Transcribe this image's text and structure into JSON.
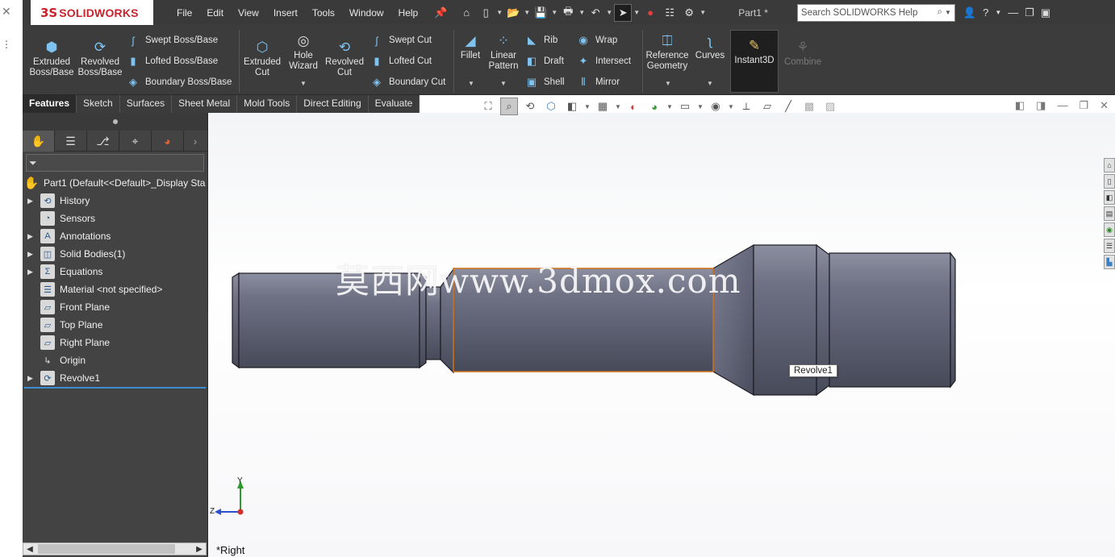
{
  "app": {
    "brand_prefix": "3S",
    "brand_name": "SOLIDWORKS",
    "document_title": "Part1 *",
    "search_placeholder": "Search SOLIDWORKS Help"
  },
  "menu": [
    "File",
    "Edit",
    "View",
    "Insert",
    "Tools",
    "Window",
    "Help"
  ],
  "commands": {
    "extruded_boss": "Extruded\nBoss/Base",
    "revolved_boss": "Revolved\nBoss/Base",
    "swept_boss": "Swept Boss/Base",
    "lofted_boss": "Lofted Boss/Base",
    "boundary_boss": "Boundary Boss/Base",
    "extruded_cut": "Extruded\nCut",
    "hole_wizard": "Hole\nWizard",
    "revolved_cut": "Revolved\nCut",
    "swept_cut": "Swept Cut",
    "lofted_cut": "Lofted Cut",
    "boundary_cut": "Boundary Cut",
    "fillet": "Fillet",
    "linear_pattern": "Linear\nPattern",
    "rib": "Rib",
    "draft": "Draft",
    "shell": "Shell",
    "wrap": "Wrap",
    "intersect": "Intersect",
    "mirror": "Mirror",
    "reference_geometry": "Reference\nGeometry",
    "curves": "Curves",
    "instant3d": "Instant3D",
    "combine": "Combine"
  },
  "tabs": [
    "Features",
    "Sketch",
    "Surfaces",
    "Sheet Metal",
    "Mold Tools",
    "Direct Editing",
    "Evaluate"
  ],
  "active_tab": "Features",
  "tree": {
    "root": "Part1  (Default<<Default>_Display Sta",
    "items": [
      {
        "label": "History",
        "expandable": true
      },
      {
        "label": "Sensors",
        "expandable": false
      },
      {
        "label": "Annotations",
        "expandable": true
      },
      {
        "label": "Solid Bodies(1)",
        "expandable": true
      },
      {
        "label": "Equations",
        "expandable": true
      },
      {
        "label": "Material <not specified>",
        "expandable": false
      },
      {
        "label": "Front Plane",
        "expandable": false
      },
      {
        "label": "Top Plane",
        "expandable": false
      },
      {
        "label": "Right Plane",
        "expandable": false
      },
      {
        "label": "Origin",
        "expandable": false
      },
      {
        "label": "Revolve1",
        "expandable": true
      }
    ]
  },
  "viewport": {
    "tooltip": "Revolve1",
    "watermark": "莫西网www.3dmox.com",
    "view_name": "*Right",
    "triad_y": "Y",
    "triad_z": "Z"
  },
  "colors": {
    "accent": "#3d8fd1",
    "part_body": "#6e7182",
    "highlight_edge": "#e07a1a",
    "brand_red": "#c8232c"
  }
}
